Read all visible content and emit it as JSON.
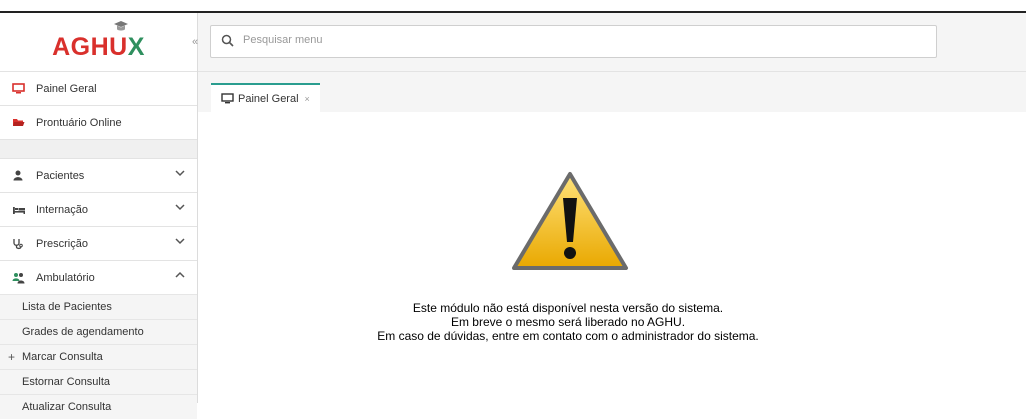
{
  "logo": {
    "text_main": "AGHU",
    "text_accent": "X",
    "colors": {
      "main": "#d9302c",
      "accent": "#2e8f5e"
    }
  },
  "search": {
    "placeholder": "Pesquisar menu",
    "value": ""
  },
  "collapse_label": "«",
  "sidebar": {
    "items": [
      {
        "label": "Painel Geral",
        "icon": "monitor-icon"
      },
      {
        "label": "Prontuário Online",
        "icon": "folder-open-icon"
      }
    ],
    "groups": [
      {
        "label": "Pacientes",
        "icon": "user-icon",
        "expanded": false
      },
      {
        "label": "Internação",
        "icon": "bed-icon",
        "expanded": false
      },
      {
        "label": "Prescrição",
        "icon": "stethoscope-icon",
        "expanded": false
      },
      {
        "label": "Ambulatório",
        "icon": "users-icon",
        "expanded": true
      }
    ],
    "subitems": [
      {
        "label": "Lista de Pacientes"
      },
      {
        "label": "Grades de agendamento"
      },
      {
        "label": "Marcar Consulta",
        "prefix": "+"
      },
      {
        "label": "Estornar Consulta"
      },
      {
        "label": "Atualizar Consulta"
      }
    ]
  },
  "tabs": [
    {
      "label": "Painel Geral",
      "icon": "monitor-icon",
      "close": "×"
    }
  ],
  "message": {
    "line1": "Este módulo não está disponível nesta versão do sistema.",
    "line2": "Em breve o mesmo será liberado no AGHU.",
    "line3": "Em caso de dúvidas, entre em contato com o administrador do sistema."
  },
  "colors": {
    "accent_red": "#d9302c",
    "accent_green": "#2e8f5e",
    "tab_border": "#2a9d8f",
    "warning_yellow": "#f2c200"
  }
}
